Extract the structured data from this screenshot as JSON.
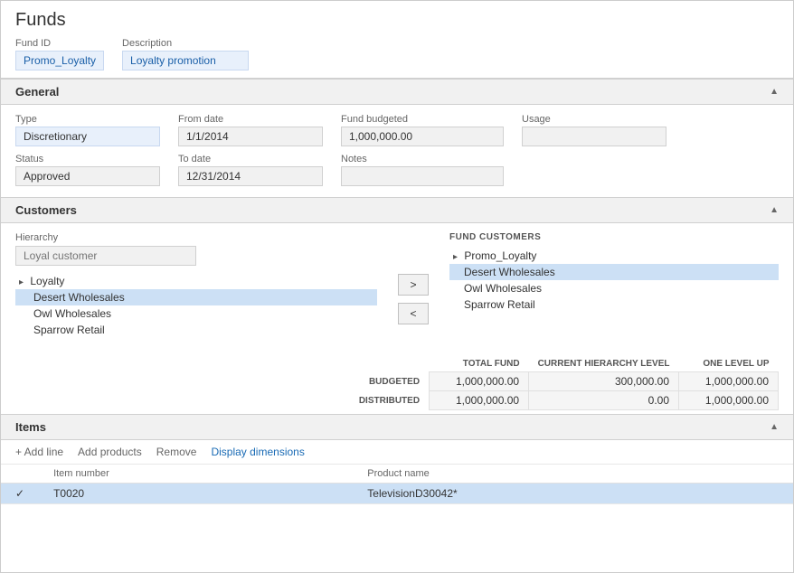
{
  "page": {
    "title": "Funds"
  },
  "fund": {
    "id_label": "Fund ID",
    "id_value": "Promo_Loyalty",
    "desc_label": "Description",
    "desc_value": "Loyalty promotion"
  },
  "general": {
    "section_title": "General",
    "type_label": "Type",
    "type_value": "Discretionary",
    "from_date_label": "From date",
    "from_date_value": "1/1/2014",
    "fund_budgeted_label": "Fund budgeted",
    "fund_budgeted_value": "1,000,000.00",
    "usage_label": "Usage",
    "usage_value": "",
    "status_label": "Status",
    "status_value": "Approved",
    "to_date_label": "To date",
    "to_date_value": "12/31/2014",
    "notes_label": "Notes",
    "notes_value": ""
  },
  "customers": {
    "section_title": "Customers",
    "hierarchy_label": "Hierarchy",
    "hierarchy_placeholder": "Loyal customer",
    "arrow_right": ">",
    "arrow_left": "<",
    "fund_customers_label": "FUND CUSTOMERS",
    "left_tree": [
      {
        "id": "loyalty",
        "label": "Loyalty",
        "level": 0,
        "arrow": true
      },
      {
        "id": "desert",
        "label": "Desert Wholesales",
        "level": 1,
        "selected": true
      },
      {
        "id": "owl",
        "label": "Owl Wholesales",
        "level": 1
      },
      {
        "id": "sparrow",
        "label": "Sparrow Retail",
        "level": 1
      }
    ],
    "right_tree": [
      {
        "id": "promo",
        "label": "Promo_Loyalty",
        "level": 0,
        "arrow": true
      },
      {
        "id": "desert_r",
        "label": "Desert Wholesales",
        "level": 1,
        "selected": true
      },
      {
        "id": "owl_r",
        "label": "Owl Wholesales",
        "level": 1
      },
      {
        "id": "sparrow_r",
        "label": "Sparrow Retail",
        "level": 1
      }
    ]
  },
  "totals": {
    "col_headers": [
      "",
      "TOTAL FUND",
      "CURRENT HIERARCHY LEVEL",
      "ONE LEVEL UP"
    ],
    "rows": [
      {
        "label": "BUDGETED",
        "total_fund": "1,000,000.00",
        "current_hierarchy": "300,000.00",
        "one_level_up": "1,000,000.00"
      },
      {
        "label": "DISTRIBUTED",
        "total_fund": "1,000,000.00",
        "current_hierarchy": "0.00",
        "one_level_up": "1,000,000.00"
      }
    ]
  },
  "items": {
    "section_title": "Items",
    "add_line_label": "+ Add line",
    "add_products_label": "Add products",
    "remove_label": "Remove",
    "display_dimensions_label": "Display dimensions",
    "col_check": "",
    "col_item_number": "Item number",
    "col_product_name": "Product name",
    "rows": [
      {
        "check": "✓",
        "item_number": "T0020",
        "product_name": "TelevisionD30042*",
        "selected": true
      }
    ]
  }
}
